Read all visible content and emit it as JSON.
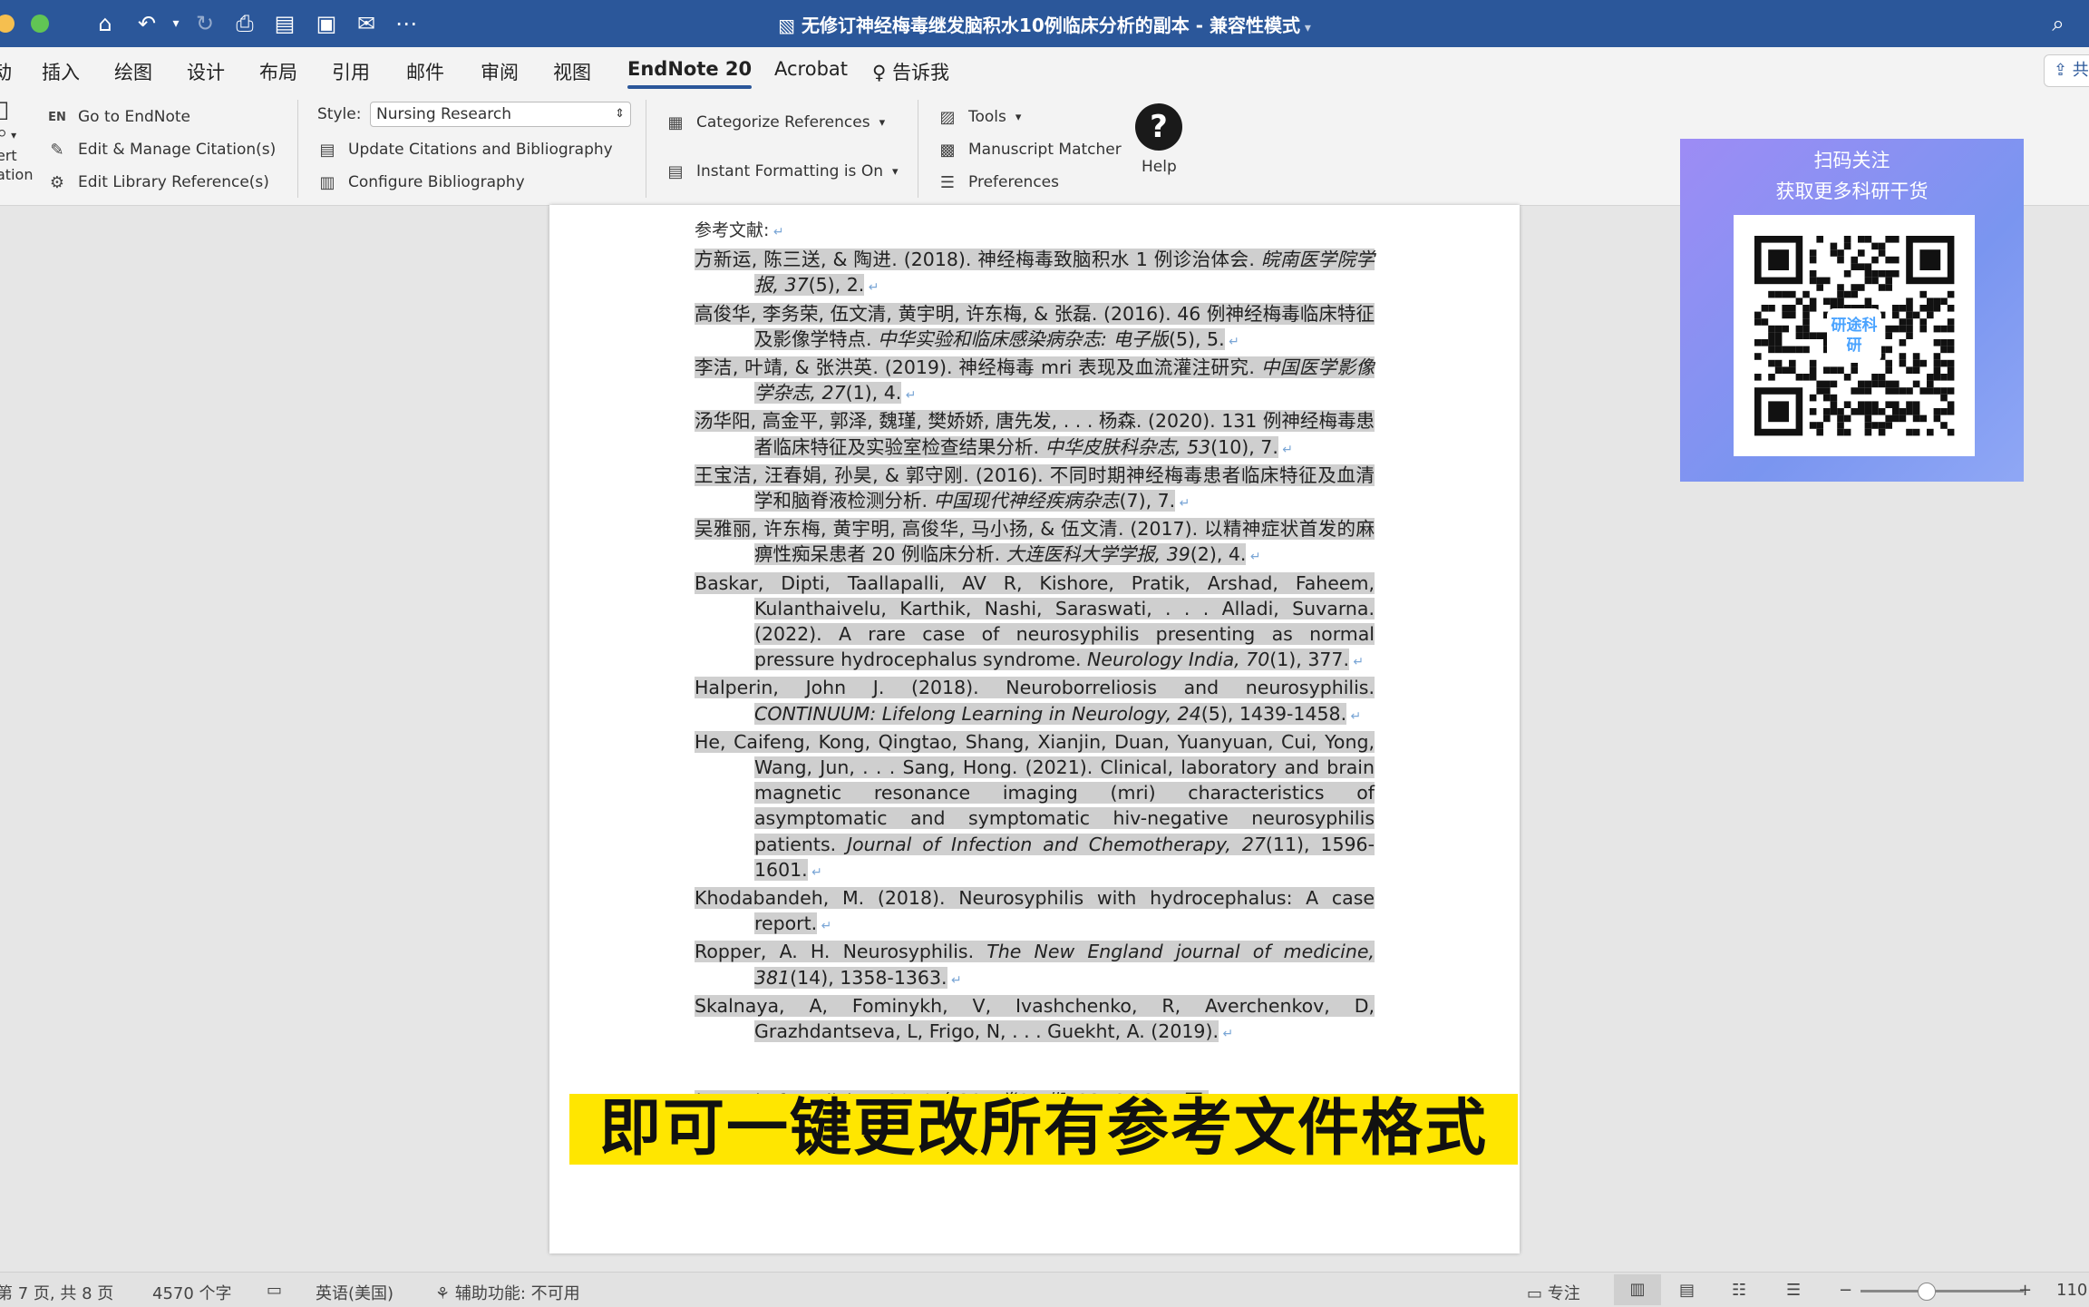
{
  "window": {
    "title": "无修订神经梅毒继发脑积水10例临床分析的副本 - 兼容性模式"
  },
  "menu": {
    "tabs": [
      "插入",
      "绘图",
      "设计",
      "布局",
      "引用",
      "邮件",
      "审阅",
      "视图",
      "EndNote 20",
      "Acrobat",
      "告诉我"
    ],
    "active": "EndNote 20"
  },
  "ribbon": {
    "insert_partial_1": "ert",
    "insert_partial_2": "ation",
    "go_to_endnote": "Go to EndNote",
    "en_badge": "EN",
    "edit_manage": "Edit & Manage Citation(s)",
    "edit_library": "Edit Library Reference(s)",
    "style_label": "Style:",
    "style_value": "Nursing Research",
    "update_citations": "Update Citations and Bibliography",
    "configure_bib": "Configure Bibliography",
    "categorize": "Categorize References",
    "instant_formatting": "Instant Formatting is On",
    "tools": "Tools",
    "manuscript_matcher": "Manuscript Matcher",
    "preferences": "Preferences",
    "help": "Help",
    "help_glyph": "?"
  },
  "document": {
    "heading": "参考文献:",
    "references": [
      {
        "parts": [
          {
            "t": "方新运, 陈三送, & 陶进. (2018). 神经梅毒致脑积水 1 例诊治体会. "
          },
          {
            "t": "皖南医学院学报, 37",
            "i": true
          },
          {
            "t": "(5), 2."
          }
        ]
      },
      {
        "parts": [
          {
            "t": "高俊华, 李务荣, 伍文清, 黄宇明, 许东梅, & 张磊. (2016). 46 例神经梅毒临床特征及影像学特点. "
          },
          {
            "t": "中华实验和临床感染病杂志: 电子版",
            "i": true
          },
          {
            "t": "(5), 5."
          }
        ]
      },
      {
        "parts": [
          {
            "t": "李洁, 叶靖, & 张洪英. (2019). 神经梅毒 mri 表现及血流灌注研究. "
          },
          {
            "t": "中国医学影像学杂志, 27",
            "i": true
          },
          {
            "t": "(1), 4."
          }
        ]
      },
      {
        "parts": [
          {
            "t": "汤华阳, 高金平, 郭泽, 魏瑾, 樊娇娇, 唐先发, . . . 杨森. (2020). 131 例神经梅毒患者临床特征及实验室检查结果分析. "
          },
          {
            "t": "中华皮肤科杂志, 53",
            "i": true
          },
          {
            "t": "(10), 7."
          }
        ]
      },
      {
        "parts": [
          {
            "t": "王宝洁, 汪春娟, 孙昊, & 郭守刚. (2016). 不同时期神经梅毒患者临床特征及血清学和脑脊液检测分析. "
          },
          {
            "t": "中国现代神经疾病杂志",
            "i": true
          },
          {
            "t": "(7), 7."
          }
        ]
      },
      {
        "parts": [
          {
            "t": "吴雅丽, 许东梅, 黄宇明, 高俊华, 马小扬, & 伍文清. (2017). 以精神症状首发的麻痹性痴呆患者 20 例临床分析. "
          },
          {
            "t": "大连医科大学学报, 39",
            "i": true
          },
          {
            "t": "(2), 4."
          }
        ]
      },
      {
        "parts": [
          {
            "t": "Baskar, Dipti, Taallapalli, AV R, Kishore, Pratik, Arshad, Faheem, Kulanthaivelu, Karthik, Nashi, Saraswati, . . . Alladi, Suvarna. (2022). A rare case of neurosyphilis presenting as normal pressure hydrocephalus syndrome. "
          },
          {
            "t": "Neurology India, 70",
            "i": true
          },
          {
            "t": "(1), 377."
          }
        ]
      },
      {
        "parts": [
          {
            "t": "Halperin, John J. (2018). Neuroborreliosis and neurosyphilis. "
          },
          {
            "t": "CONTINUUM: Lifelong Learning in Neurology, 24",
            "i": true
          },
          {
            "t": "(5), 1439-1458."
          }
        ]
      },
      {
        "parts": [
          {
            "t": "He, Caifeng, Kong, Qingtao, Shang, Xianjin, Duan, Yuanyuan, Cui, Yong, Wang, Jun, . . . Sang, Hong. (2021). Clinical, laboratory and brain magnetic resonance imaging (mri) characteristics of asymptomatic and symptomatic hiv-negative neurosyphilis patients. "
          },
          {
            "t": "Journal of Infection and Chemotherapy, 27",
            "i": true
          },
          {
            "t": "(11), 1596-1601."
          }
        ]
      },
      {
        "parts": [
          {
            "t": "Khodabandeh, M. (2018). Neurosyphilis with hydrocephalus: A case report."
          }
        ]
      },
      {
        "parts": [
          {
            "t": "Ropper, A. H. Neurosyphilis. "
          },
          {
            "t": "The New England journal of medicine, 381",
            "i": true
          },
          {
            "t": "(14), 1358-1363."
          }
        ]
      },
      {
        "parts": [
          {
            "t": "Skalnaya, A, Fominykh, V, Ivashchenko, R, Averchenkov, D, Grazhdantseva, L, Frigo, N, . . . Guekht, A. (2019)."
          }
        ]
      }
    ],
    "trailing_line": [
      {
        "t": "journal of medicine, 2019 年381 卷24 期",
        "i": true
      },
      {
        "t": ", 2376-2377 页."
      }
    ]
  },
  "caption": "即可一键更改所有参考文件格式",
  "qr_card": {
    "line1": "扫码关注",
    "line2": "获取更多科研干货",
    "logo": "研途科研"
  },
  "statusbar": {
    "page": "7 页, 共 8 页",
    "words": "4570 个字",
    "language": "英语(美国)",
    "accessibility": "辅助功能: 不可用",
    "focus": "专注",
    "zoom": "110",
    "zoom_fraction": 0.4
  },
  "colors": {
    "titlebar": "#2b579a",
    "highlight": "#cfcfcf",
    "caption_bg": "#ffe600"
  }
}
